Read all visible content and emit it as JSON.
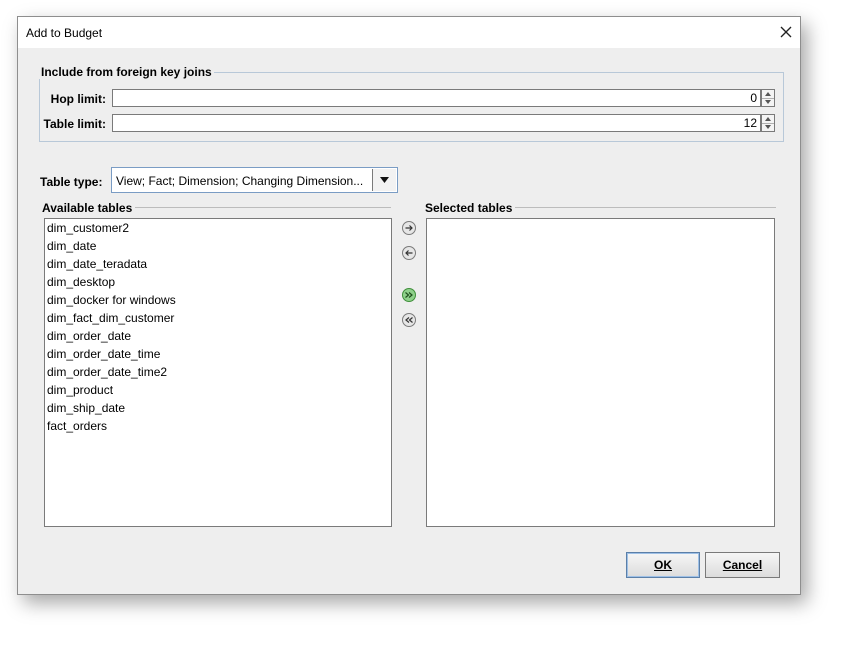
{
  "dialog": {
    "title": "Add to Budget"
  },
  "fk_group": {
    "title": "Include from foreign key joins",
    "hop_limit_label": "Hop limit:",
    "hop_limit_value": "0",
    "table_limit_label": "Table limit:",
    "table_limit_value": "12"
  },
  "table_type": {
    "label": "Table type:",
    "selected": "View; Fact; Dimension; Changing Dimension..."
  },
  "available": {
    "title": "Available tables",
    "items": [
      "dim_customer2",
      "dim_date",
      "dim_date_teradata",
      "dim_desktop",
      "dim_docker for windows",
      "dim_fact_dim_customer",
      "dim_order_date",
      "dim_order_date_time",
      "dim_order_date_time2",
      "dim_product",
      "dim_ship_date",
      "fact_orders"
    ]
  },
  "selected": {
    "title": "Selected tables",
    "items": []
  },
  "buttons": {
    "ok": "OK",
    "cancel": "Cancel"
  },
  "icons": {
    "close": "close-icon",
    "add": "arrow-right-icon",
    "remove": "arrow-left-icon",
    "add_all": "double-arrow-right-icon",
    "remove_all": "double-arrow-left-icon"
  },
  "colors": {
    "dialog_bg": "#eeeeee",
    "group_border": "#b8c8d8",
    "add_all_accent": "#4caf50"
  }
}
